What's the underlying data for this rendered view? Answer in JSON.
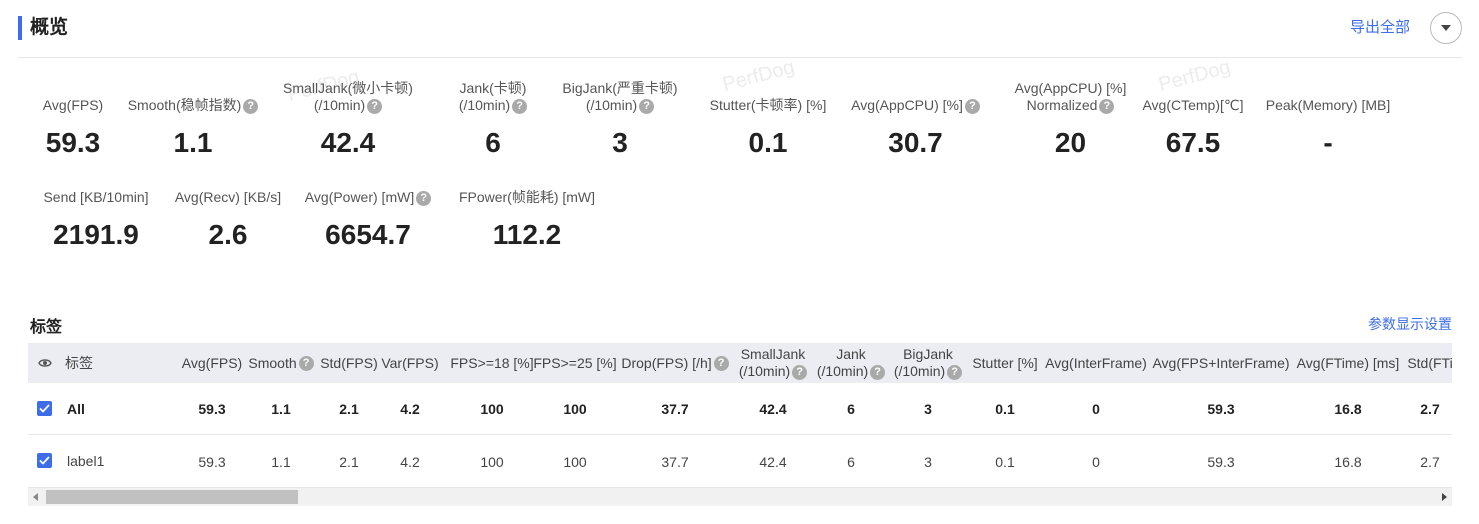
{
  "header": {
    "title": "概览",
    "export_label": "导出全部"
  },
  "watermark": "PerfDog",
  "overview": {
    "row1": [
      {
        "l1": "",
        "l2": "Avg(FPS)",
        "help": false,
        "value": "59.3"
      },
      {
        "l1": "",
        "l2": "Smooth(稳帧指数)",
        "help": true,
        "value": "1.1"
      },
      {
        "l1": "SmallJank(微小卡顿)",
        "l2": "(/10min)",
        "help": true,
        "value": "42.4"
      },
      {
        "l1": "Jank(卡顿)",
        "l2": "(/10min)",
        "help": true,
        "value": "6"
      },
      {
        "l1": "BigJank(严重卡顿)",
        "l2": "(/10min)",
        "help": true,
        "value": "3"
      },
      {
        "l1": "",
        "l2": "Stutter(卡顿率) [%]",
        "help": false,
        "value": "0.1"
      },
      {
        "l1": "",
        "l2": "Avg(AppCPU) [%]",
        "help": true,
        "value": "30.7"
      },
      {
        "l1": "Avg(AppCPU) [%]",
        "l2": "Normalized",
        "help": true,
        "value": "20"
      },
      {
        "l1": "",
        "l2": "Avg(CTemp)[℃]",
        "help": false,
        "value": "67.5"
      },
      {
        "l1": "",
        "l2": "Peak(Memory) [MB]",
        "help": false,
        "value": "-"
      }
    ],
    "row2": [
      {
        "l1": "",
        "l2": "Send [KB/10min]",
        "help": false,
        "value": "2191.9"
      },
      {
        "l1": "",
        "l2": "Avg(Recv) [KB/s]",
        "help": false,
        "value": "2.6"
      },
      {
        "l1": "",
        "l2": "Avg(Power) [mW]",
        "help": true,
        "value": "6654.7"
      },
      {
        "l1": "",
        "l2": "FPower(帧能耗) [mW]",
        "help": false,
        "value": "112.2"
      }
    ]
  },
  "tags": {
    "title": "标签",
    "settings_label": "参数显示设置",
    "eye_icon": "eye-icon",
    "columns": [
      {
        "l1": "标签",
        "l2": "",
        "help": false
      },
      {
        "l1": "Avg(FPS)",
        "l2": "",
        "help": false
      },
      {
        "l1": "Smooth",
        "l2": "",
        "help": true
      },
      {
        "l1": "Std(FPS)",
        "l2": "",
        "help": false
      },
      {
        "l1": "Var(FPS)",
        "l2": "",
        "help": false
      },
      {
        "l1": "FPS>=18 [%]",
        "l2": "",
        "help": false
      },
      {
        "l1": "FPS>=25 [%]",
        "l2": "",
        "help": false
      },
      {
        "l1": "Drop(FPS) [/h]",
        "l2": "",
        "help": true
      },
      {
        "l1": "SmallJank",
        "l2": "(/10min)",
        "help": true
      },
      {
        "l1": "Jank",
        "l2": "(/10min)",
        "help": true
      },
      {
        "l1": "BigJank",
        "l2": "(/10min)",
        "help": true
      },
      {
        "l1": "Stutter [%]",
        "l2": "",
        "help": false
      },
      {
        "l1": "Avg(InterFrame)",
        "l2": "",
        "help": false
      },
      {
        "l1": "Avg(FPS+InterFrame)",
        "l2": "",
        "help": false
      },
      {
        "l1": "Avg(FTime) [ms]",
        "l2": "",
        "help": false
      },
      {
        "l1": "Std(FTi",
        "l2": "",
        "help": false
      }
    ],
    "rows": [
      {
        "label": "All",
        "checked": true,
        "bold": true,
        "values": [
          "59.3",
          "1.1",
          "2.1",
          "4.2",
          "100",
          "100",
          "37.7",
          "42.4",
          "6",
          "3",
          "0.1",
          "0",
          "59.3",
          "16.8",
          "2.7"
        ]
      },
      {
        "label": "label1",
        "checked": true,
        "bold": false,
        "values": [
          "59.3",
          "1.1",
          "2.1",
          "4.2",
          "100",
          "100",
          "37.7",
          "42.4",
          "6",
          "3",
          "0.1",
          "0",
          "59.3",
          "16.8",
          "2.7"
        ]
      }
    ]
  },
  "colors": {
    "accent": "#3d6ee8",
    "header_bg": "#ebedf2"
  }
}
